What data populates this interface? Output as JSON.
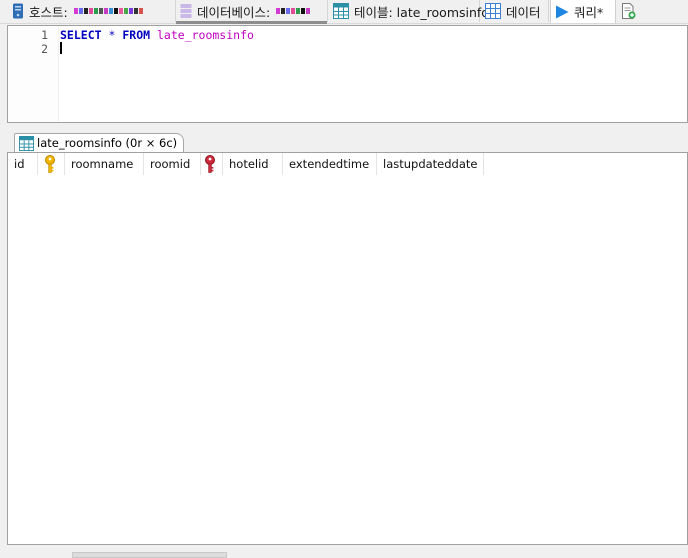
{
  "tabs": [
    {
      "label": "호스트:",
      "icon": "server-icon",
      "active": false
    },
    {
      "label": "데이터베이스:",
      "icon": "database-icon",
      "active": false
    },
    {
      "label": "테이블: late_roomsinfo",
      "icon": "table-icon",
      "active": false
    },
    {
      "label": "데이터",
      "icon": "grid-icon",
      "active": false
    },
    {
      "label": "쿼리*",
      "icon": "play-icon",
      "active": true
    }
  ],
  "new_query_icon": "new-query-tab-icon",
  "editor": {
    "line_numbers": [
      "1",
      "2"
    ],
    "tokens": {
      "select": "SELECT",
      "star": "*",
      "from": "FROM",
      "table": "late_roomsinfo"
    }
  },
  "result_tab": {
    "label": "late_roomsinfo (0r × 6c)"
  },
  "grid": {
    "columns": [
      {
        "name": "id",
        "key": null
      },
      {
        "name": "",
        "key": "primary-key-icon"
      },
      {
        "name": "roomname",
        "key": null
      },
      {
        "name": "roomid",
        "key": null
      },
      {
        "name": "",
        "key": "foreign-key-icon"
      },
      {
        "name": "hotelid",
        "key": null
      },
      {
        "name": "extendedtime",
        "key": null
      },
      {
        "name": "lastupdateddate",
        "key": null
      }
    ],
    "rows": []
  },
  "colors": {
    "keyword": "#0000c0",
    "table_name": "#c000c0",
    "primary_key": "#f2b400",
    "foreign_key": "#cc2a3c"
  }
}
